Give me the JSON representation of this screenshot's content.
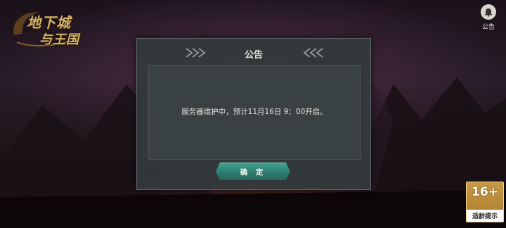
{
  "logo": {
    "line1": "地下城",
    "line2": "与王国"
  },
  "top_right": {
    "notice_label": "公告"
  },
  "dialog": {
    "title": "公告",
    "message": "服务器维护中，预计11月16日 9：00开启。",
    "confirm_label": "确 定"
  },
  "age_rating": {
    "number": "16+",
    "label": "适龄提示"
  },
  "colors": {
    "confirm_button": "#2d7d70",
    "dialog_bg": "#343a3c",
    "badge": "#c79a46"
  },
  "icons": {
    "notice": "bell-icon",
    "decor": "chevron-divider-icon"
  }
}
